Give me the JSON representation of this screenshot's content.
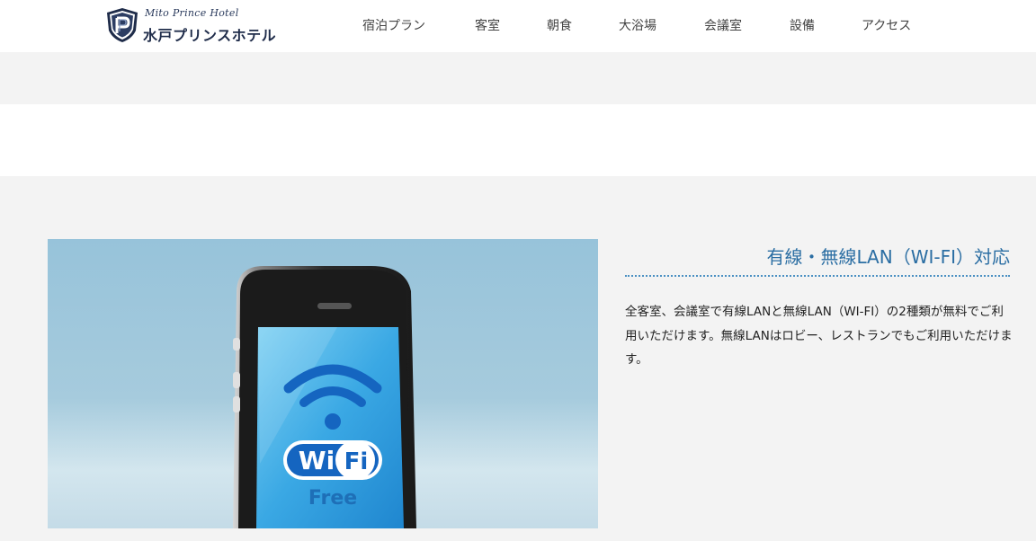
{
  "header": {
    "logo_script": "Mito Prince Hotel",
    "logo_name": "水戸プリンスホテル",
    "nav": [
      {
        "label": "宿泊プラン"
      },
      {
        "label": "客室"
      },
      {
        "label": "朝食"
      },
      {
        "label": "大浴場"
      },
      {
        "label": "会議室"
      },
      {
        "label": "設備"
      },
      {
        "label": "アクセス"
      }
    ]
  },
  "feature": {
    "title": "有線・無線LAN（WI-FI）対応",
    "description": "全客室、会議室で有線LANと無線LAN（WI-FI）の2種類が無料でご利用いただけます。無線LANはロビー、レストランでもご利用いただけます。",
    "image": {
      "badge_wi": "Wi",
      "badge_fi": "Fi",
      "free_text": "Free"
    }
  },
  "colors": {
    "accent": "#2b6ea3",
    "background_gray": "#f3f3f3",
    "navy": "#1f2c4a"
  }
}
